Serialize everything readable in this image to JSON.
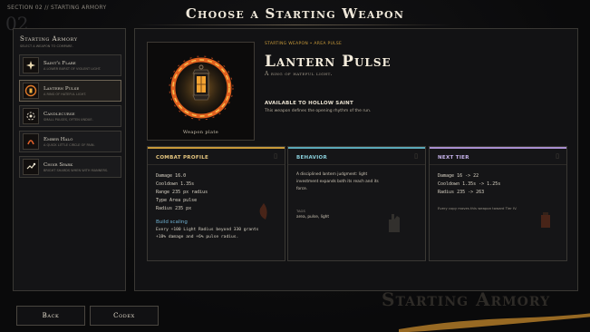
{
  "breadcrumb": "SECTION 02  //  STARTING ARMORY",
  "section_number": "02",
  "page_title": "Choose a Starting Weapon",
  "armory": {
    "title": "Starting Armory",
    "subtitle": "SELECT A WEAPON TO COMPARE.",
    "items": [
      {
        "name": "Saint's Flare",
        "desc": "A LOWER BURST OF VIOLENT LIGHT.",
        "icon": "flare-icon",
        "selected": false
      },
      {
        "name": "Lantern Pulse",
        "desc": "A RING OF HATEFUL LIGHT.",
        "icon": "lantern-icon",
        "selected": true
      },
      {
        "name": "Candlecurse",
        "desc": "SMALL PULSES, OFTEN UNDUE.",
        "icon": "candle-icon",
        "selected": false
      },
      {
        "name": "Ember Halo",
        "desc": "A QUICK LITTLE CIRCLE OF PAIN.",
        "icon": "halo-icon",
        "selected": false
      },
      {
        "name": "Choir Spark",
        "desc": "BRIGHT SHARDS WHEN WITH MANNERS.",
        "icon": "spark-icon",
        "selected": false
      }
    ]
  },
  "detail": {
    "portrait_caption": "Weapon plate",
    "tag": "STARTING WEAPON  •  AREA PULSE",
    "name": "Lantern Pulse",
    "subtitle": "A ring of hateful light.",
    "availability": "AVAILABLE TO HOLLOW SAINT",
    "availability_desc": "This weapon defines the opening rhythm of the run."
  },
  "cards": {
    "combat": {
      "title": "COMBAT PROFILE",
      "accent": "#c89a3a",
      "stats": [
        "Damage 16.0",
        "Cooldown 1.35s",
        "Range 235 px radius",
        "Type Area pulse",
        "Radius 235 px"
      ],
      "scaling_title": "Build scaling",
      "scaling_lines": [
        "Every +100 Light Radius beyond 330 grants",
        "+18% damage and +6% pulse radius."
      ]
    },
    "behavior": {
      "title": "BEHAVIOR",
      "accent": "#5aa8b8",
      "desc_lines": [
        "A disciplined lantern judgment: light",
        "investment expands both its reach and its",
        "force."
      ],
      "tags_label": "TAGS",
      "tags": "area, pulse, light"
    },
    "next": {
      "title": "NEXT TIER",
      "accent": "#a98ed0",
      "lines": [
        "Damage 16 -> 22",
        "Cooldown 1.35s -> 1.25s",
        "Radius 235 -> 263"
      ],
      "footer": "Every copy moves this weapon toward Tier IV."
    }
  },
  "buttons": {
    "back": "Back",
    "codex": "Codex"
  },
  "watermark": "Starting Armory"
}
